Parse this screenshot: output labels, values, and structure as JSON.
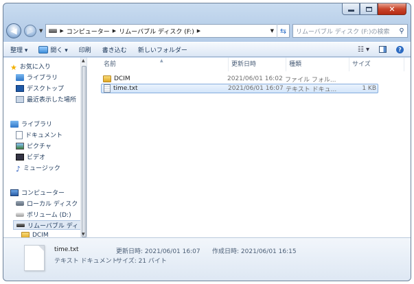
{
  "address": {
    "crumbs": [
      "コンピューター",
      "リムーバブル ディスク (F:)"
    ],
    "search_placeholder": "リムーバブル ディスク (F:)の検索"
  },
  "toolbar": {
    "organize": "整理 ▾",
    "open": "開く ▾",
    "print": "印刷",
    "burn": "書き込む",
    "new_folder": "新しいフォルダー"
  },
  "nav": {
    "favorites": "お気に入り",
    "fav_items": [
      "ライブラリ",
      "デスクトップ",
      "最近表示した場所"
    ],
    "libraries": "ライブラリ",
    "lib_items": [
      "ドキュメント",
      "ピクチャ",
      "ビデオ",
      "ミュージック"
    ],
    "computer": "コンピューター",
    "comp_items": [
      "ローカル ディスク",
      "ボリューム (D:)",
      "リムーバブル ディ"
    ],
    "dcim": "DCIM"
  },
  "columns": {
    "name": "名前",
    "date": "更新日時",
    "type": "種類",
    "size": "サイズ"
  },
  "files": [
    {
      "name": "DCIM",
      "date": "2021/06/01 16:02",
      "type": "ファイル フォル...",
      "size": ""
    },
    {
      "name": "time.txt",
      "date": "2021/06/01 16:07",
      "type": "テキスト ドキュ...",
      "size": "1 KB"
    }
  ],
  "details": {
    "name": "time.txt",
    "type": "テキスト ドキュメント",
    "modified": "更新日時: 2021/06/01 16:07",
    "created": "作成日時: 2021/06/01 16:15",
    "size": "サイズ: 21 バイト"
  }
}
